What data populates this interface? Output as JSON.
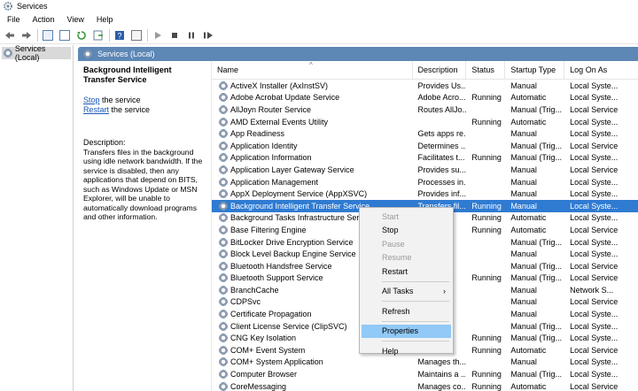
{
  "window": {
    "title": "Services"
  },
  "menu": [
    "File",
    "Action",
    "View",
    "Help"
  ],
  "toolbar": [
    "back-icon",
    "forward-icon",
    "show-hide-tree-icon",
    "properties-icon",
    "refresh-icon",
    "export-icon",
    "help-icon",
    "console-icon",
    "start-icon",
    "stop-icon",
    "pause-icon",
    "restart-icon"
  ],
  "tree": {
    "item": "Services (Local)"
  },
  "panel": {
    "title": "Services (Local)"
  },
  "details": {
    "service_name": "Background Intelligent Transfer Service",
    "stop_link": "Stop",
    "stop_suffix": " the service",
    "restart_link": "Restart",
    "restart_suffix": " the service",
    "description_label": "Description:",
    "description": "Transfers files in the background using idle network bandwidth. If the service is disabled, then any applications that depend on BITS, such as Windows Update or MSN Explorer, will be unable to automatically download programs and other information."
  },
  "columns": {
    "name": "Name",
    "description": "Description",
    "status": "Status",
    "startup": "Startup Type",
    "logon": "Log On As"
  },
  "rows": [
    {
      "name": "ActiveX Installer (AxInstSV)",
      "description": "Provides Us...",
      "status": "",
      "startup": "Manual",
      "logon": "Local Syste..."
    },
    {
      "name": "Adobe Acrobat Update Service",
      "description": "Adobe Acro...",
      "status": "Running",
      "startup": "Automatic",
      "logon": "Local Syste..."
    },
    {
      "name": "AllJoyn Router Service",
      "description": "Routes AllJo...",
      "status": "",
      "startup": "Manual (Trig...",
      "logon": "Local Service"
    },
    {
      "name": "AMD External Events Utility",
      "description": "",
      "status": "Running",
      "startup": "Automatic",
      "logon": "Local Syste..."
    },
    {
      "name": "App Readiness",
      "description": "Gets apps re...",
      "status": "",
      "startup": "Manual",
      "logon": "Local Syste..."
    },
    {
      "name": "Application Identity",
      "description": "Determines ...",
      "status": "",
      "startup": "Manual (Trig...",
      "logon": "Local Service"
    },
    {
      "name": "Application Information",
      "description": "Facilitates t...",
      "status": "Running",
      "startup": "Manual (Trig...",
      "logon": "Local Syste..."
    },
    {
      "name": "Application Layer Gateway Service",
      "description": "Provides su...",
      "status": "",
      "startup": "Manual",
      "logon": "Local Service"
    },
    {
      "name": "Application Management",
      "description": "Processes in...",
      "status": "",
      "startup": "Manual",
      "logon": "Local Syste..."
    },
    {
      "name": "AppX Deployment Service (AppXSVC)",
      "description": "Provides inf...",
      "status": "",
      "startup": "Manual",
      "logon": "Local Syste..."
    },
    {
      "name": "Background Intelligent Transfer Service",
      "description": "Transfers fil...",
      "status": "Running",
      "startup": "Manual",
      "logon": "Local Syste...",
      "selected": true
    },
    {
      "name": "Background Tasks Infrastructure Service",
      "description": "",
      "status": "Running",
      "startup": "Automatic",
      "logon": "Local Syste..."
    },
    {
      "name": "Base Filtering Engine",
      "description": "",
      "status": "Running",
      "startup": "Automatic",
      "logon": "Local Service"
    },
    {
      "name": "BitLocker Drive Encryption Service",
      "description": "",
      "status": "",
      "startup": "Manual (Trig...",
      "logon": "Local Syste..."
    },
    {
      "name": "Block Level Backup Engine Service",
      "description": "",
      "status": "",
      "startup": "Manual",
      "logon": "Local Syste..."
    },
    {
      "name": "Bluetooth Handsfree Service",
      "description": "",
      "status": "",
      "startup": "Manual (Trig...",
      "logon": "Local Service"
    },
    {
      "name": "Bluetooth Support Service",
      "description": "",
      "status": "Running",
      "startup": "Manual (Trig...",
      "logon": "Local Service"
    },
    {
      "name": "BranchCache",
      "description": "",
      "status": "",
      "startup": "Manual",
      "logon": "Network S..."
    },
    {
      "name": "CDPSvc",
      "description": "",
      "status": "",
      "startup": "Manual",
      "logon": "Local Service"
    },
    {
      "name": "Certificate Propagation",
      "description": "",
      "status": "",
      "startup": "Manual",
      "logon": "Local Syste..."
    },
    {
      "name": "Client License Service (ClipSVC)",
      "description": "",
      "status": "",
      "startup": "Manual (Trig...",
      "logon": "Local Syste..."
    },
    {
      "name": "CNG Key Isolation",
      "description": "",
      "status": "Running",
      "startup": "Manual (Trig...",
      "logon": "Local Syste..."
    },
    {
      "name": "COM+ Event System",
      "description": "",
      "status": "Running",
      "startup": "Automatic",
      "logon": "Local Service"
    },
    {
      "name": "COM+ System Application",
      "description": "Manages th...",
      "status": "",
      "startup": "Manual",
      "logon": "Local Syste..."
    },
    {
      "name": "Computer Browser",
      "description": "Maintains a ...",
      "status": "Running",
      "startup": "Manual (Trig...",
      "logon": "Local Syste..."
    },
    {
      "name": "CoreMessaging",
      "description": "Manages co...",
      "status": "Running",
      "startup": "Automatic",
      "logon": "Local Service"
    }
  ],
  "context_menu": {
    "start": "Start",
    "stop": "Stop",
    "pause": "Pause",
    "resume": "Resume",
    "restart": "Restart",
    "all_tasks": "All Tasks",
    "all_tasks_arrow": "›",
    "refresh": "Refresh",
    "properties": "Properties",
    "help": "Help"
  }
}
